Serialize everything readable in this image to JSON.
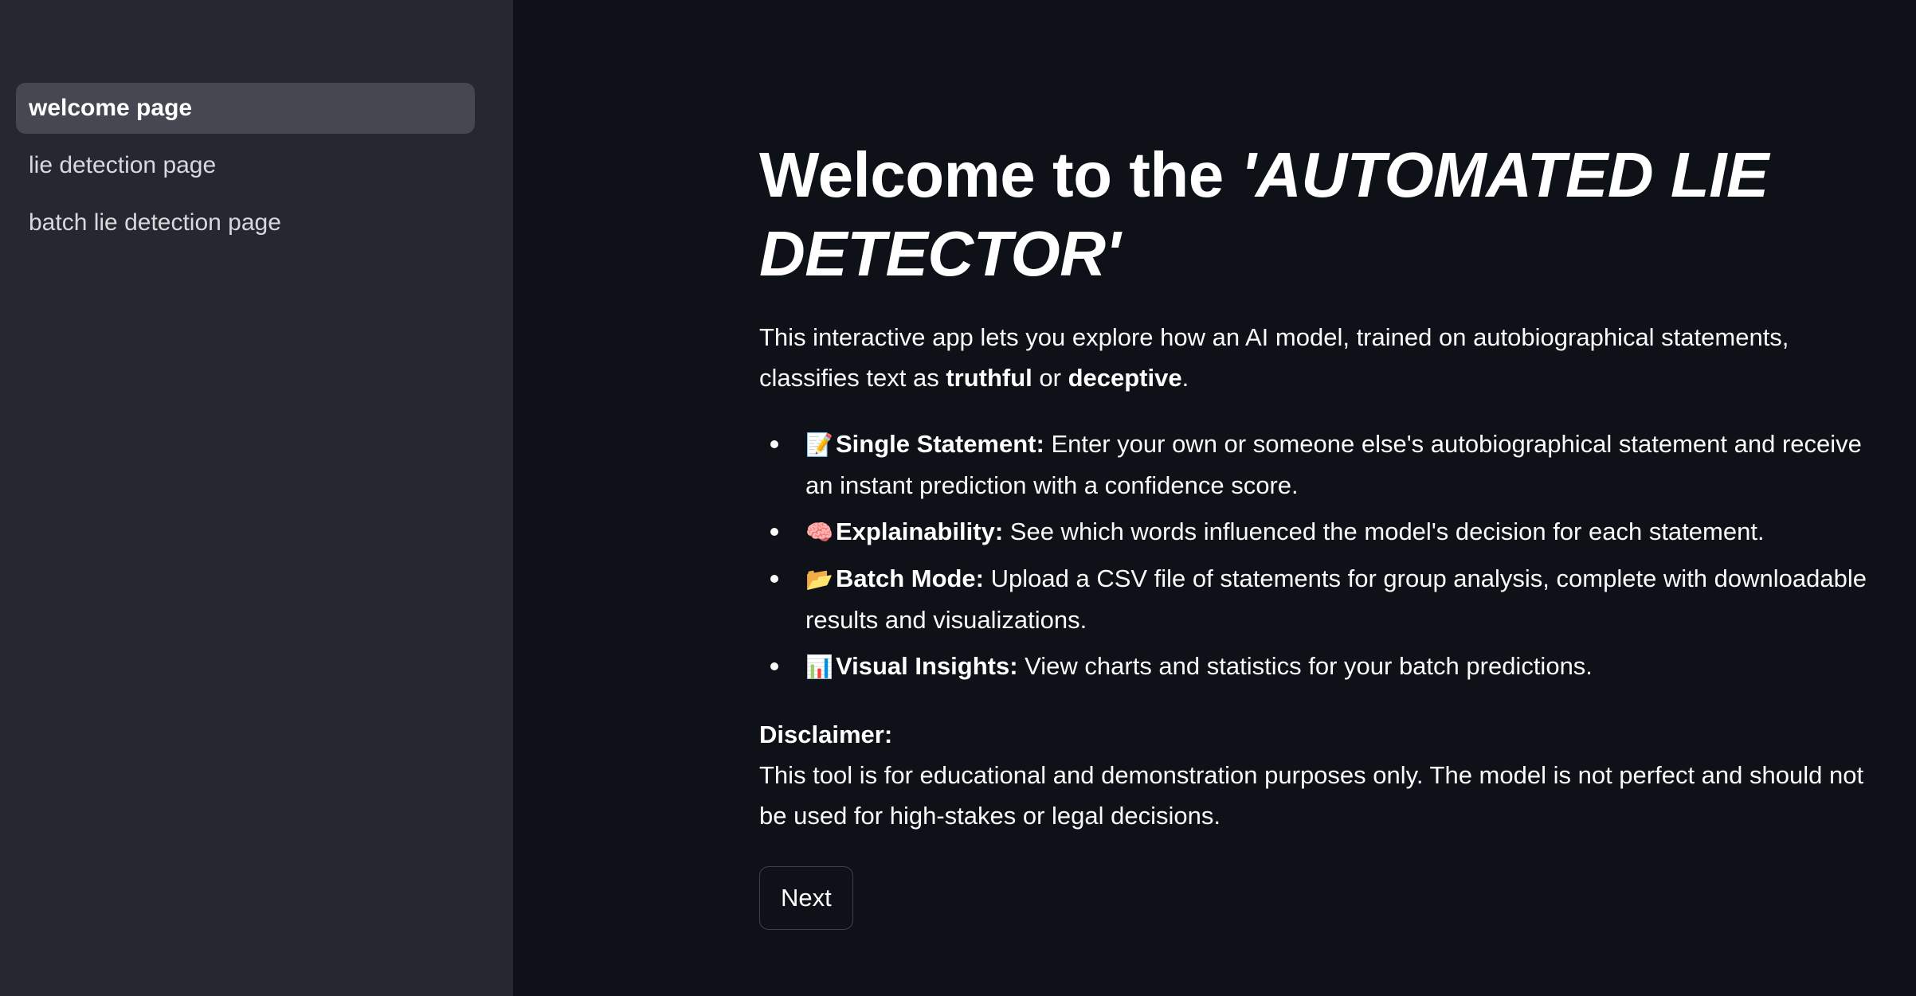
{
  "sidebar": {
    "items": [
      {
        "label": "welcome page",
        "active": true
      },
      {
        "label": "lie detection page",
        "active": false
      },
      {
        "label": "batch lie detection page",
        "active": false
      }
    ]
  },
  "main": {
    "title_prefix": "Welcome to the ",
    "title_emphasis": "'AUTOMATED LIE DETECTOR'",
    "intro": {
      "text_before": "This interactive app lets you explore how an AI model, trained on autobiographical statements, classifies text as ",
      "truthful": "truthful",
      "or": " or ",
      "deceptive": "deceptive",
      "period": "."
    },
    "features": [
      {
        "icon": "memo-icon",
        "emoji": "📝",
        "title": "Single Statement:",
        "text": " Enter your own or someone else's autobiographical statement and receive an instant prediction with a confidence score."
      },
      {
        "icon": "brain-icon",
        "emoji": "🧠",
        "title": "Explainability:",
        "text": " See which words influenced the model's decision for each statement."
      },
      {
        "icon": "folder-icon",
        "emoji": "📂",
        "title": "Batch Mode:",
        "text": " Upload a CSV file of statements for group analysis, complete with downloadable results and visualizations."
      },
      {
        "icon": "bar-chart-icon",
        "emoji": "📊",
        "title": "Visual Insights:",
        "text": " View charts and statistics for your batch predictions."
      }
    ],
    "disclaimer_label": "Disclaimer:",
    "disclaimer_text": "This tool is for educational and demonstration purposes only. The model is not perfect and should not be used for high-stakes or legal decisions.",
    "next_label": "Next"
  },
  "colors": {
    "background": "#0e1117",
    "sidebar": "#262730",
    "sidebar_active": "#464851",
    "text": "#fafafa"
  }
}
